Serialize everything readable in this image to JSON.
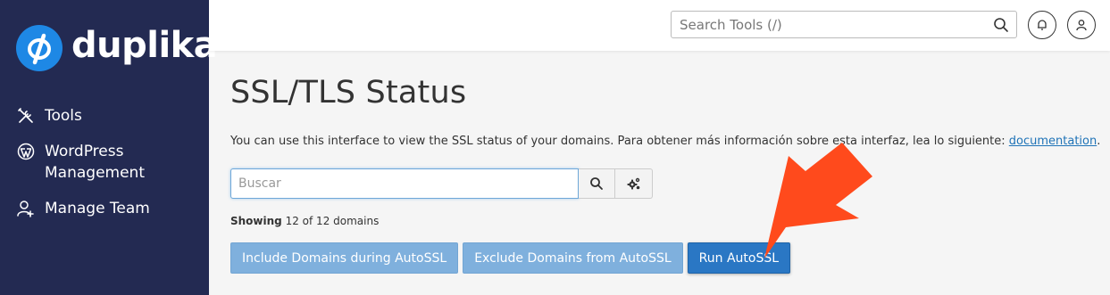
{
  "brand": {
    "name": "duplika",
    "color": "#1e88e5"
  },
  "sidebar": {
    "items": [
      {
        "label": "Tools",
        "icon": "tools-icon"
      },
      {
        "label": "WordPress Management",
        "icon": "wordpress-icon"
      },
      {
        "label": "Manage Team",
        "icon": "team-icon"
      }
    ]
  },
  "header": {
    "search_placeholder": "Search Tools (/)",
    "icons": [
      "search-icon",
      "bell-icon",
      "user-icon"
    ]
  },
  "main": {
    "title": "SSL/TLS Status",
    "description": "You can use this interface to view the SSL status of your domains. Para obtener más información sobre esta interfaz, lea lo siguiente: ",
    "description_link": "documentation",
    "description_end": ".",
    "filter_placeholder": "Buscar",
    "showing_label": "Showing",
    "showing_count": "12 of 12 domains",
    "buttons": {
      "include": "Include Domains during AutoSSL",
      "exclude": "Exclude Domains from AutoSSL",
      "run": "Run AutoSSL"
    }
  },
  "colors": {
    "sidebar_bg": "#232a52",
    "primary": "#2a77c4",
    "light_button": "#7fb0dd",
    "annotation_arrow": "#ff4a1c"
  }
}
